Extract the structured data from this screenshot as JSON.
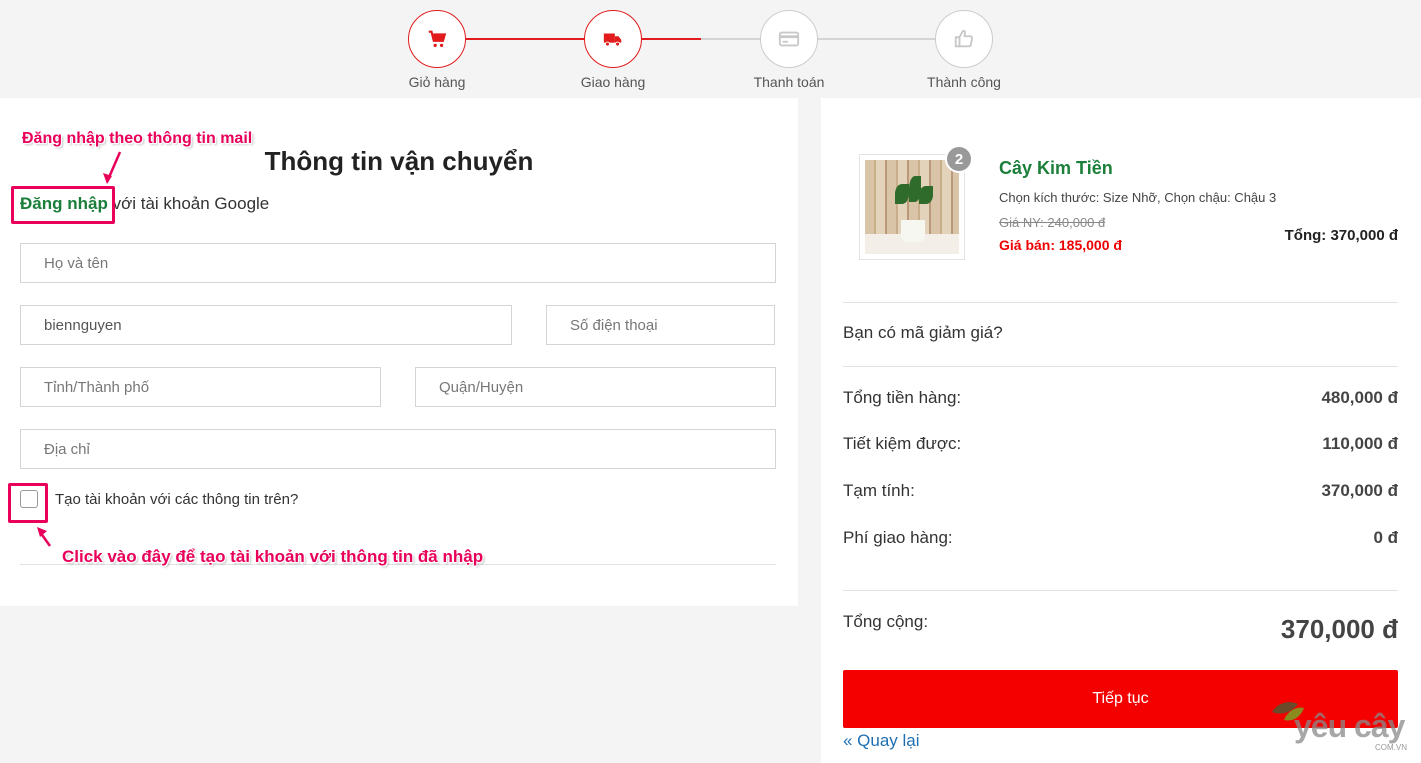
{
  "stepper": {
    "steps": [
      {
        "label": "Giỏ hàng",
        "icon": "cart-icon",
        "state": "done"
      },
      {
        "label": "Giao hàng",
        "icon": "truck-icon",
        "state": "active"
      },
      {
        "label": "Thanh toán",
        "icon": "credit-card-icon",
        "state": "pending"
      },
      {
        "label": "Thành công",
        "icon": "thumbs-up-icon",
        "state": "pending"
      }
    ],
    "active_color": "#e21c1c",
    "pending_color": "#cccccc"
  },
  "shipping": {
    "title": "Thông tin vận chuyển",
    "login_link": "Đăng nhập",
    "login_suffix": " với tài khoản Google",
    "fields": {
      "fullname_placeholder": "Họ và tên",
      "email_value": "biennguyen",
      "phone_placeholder": "Số điện thoại",
      "city_placeholder": "Tỉnh/Thành phố",
      "district_placeholder": "Quận/Huyện",
      "address_placeholder": "Địa chỉ"
    },
    "create_account_label": "Tạo tài khoản với các thông tin trên?",
    "create_account_checked": false
  },
  "annotations": {
    "mail_login": "Đăng nhập theo thông tin mail",
    "create_account_hint": "Click vào đây để tạo tài khoản với thông tin đã nhập",
    "color": "#e8005a"
  },
  "order": {
    "item": {
      "name": "Cây Kim Tiền",
      "variant": "Chọn kích thước: Size Nhỡ, Chọn chậu: Chậu 3",
      "old_price": "Giá NY: 240,000 đ",
      "sale_price": "Giá bán: 185,000 đ",
      "total": "Tổng: 370,000 đ",
      "quantity": "2"
    },
    "discount_prompt": "Bạn có mã giảm giá?",
    "summary": [
      {
        "label": "Tổng tiền hàng:",
        "value": "480,000 đ"
      },
      {
        "label": "Tiết kiệm được:",
        "value": "110,000 đ"
      },
      {
        "label": "Tạm tính:",
        "value": "370,000 đ"
      },
      {
        "label": "Phí giao hàng:",
        "value": "0 đ"
      }
    ],
    "grand_total_label": "Tổng cộng:",
    "grand_total_value": "370,000 đ",
    "continue_button": "Tiếp tục",
    "back_link": "« Quay lại"
  },
  "brand": {
    "logo_text": "yêu cây",
    "logo_sub": "COM.VN"
  }
}
